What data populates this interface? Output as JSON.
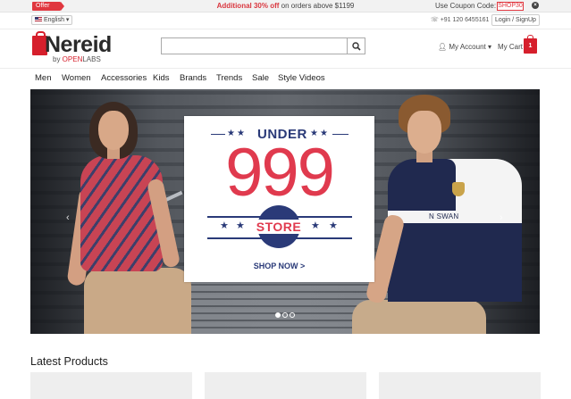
{
  "promo": {
    "offer_badge": "Offer",
    "highlight": "Additional 30% off",
    "text": " on orders above $1199",
    "coupon_label": "Use Coupon Code:",
    "coupon_code": "SHOP30",
    "close_glyph": "×"
  },
  "utility": {
    "language": "English",
    "phone": "+91 120 6455161",
    "login": "Login / SignUp"
  },
  "header": {
    "logo_main": "Nereid",
    "logo_by": "by ",
    "logo_open": "OPEN",
    "logo_labs": "LABS",
    "search_placeholder": "",
    "account": "My Account",
    "cart": "My Cart",
    "cart_count": "1"
  },
  "nav": [
    "Men",
    "Women",
    "Accessories",
    "Kids",
    "Brands",
    "Trends",
    "Sale",
    "Style Videos"
  ],
  "banner": {
    "under": "UNDER",
    "price": "999",
    "store": "STORE",
    "shop_now": "SHOP NOW >",
    "shirt_text": "N SWAN",
    "prev": "‹",
    "next": "›",
    "slide_count": 3,
    "active_slide": 1
  },
  "latest": {
    "title": "Latest Products"
  },
  "colors": {
    "brand_red": "#d61f2c",
    "sale_red": "#e03a4e",
    "navy": "#2a3a78"
  },
  "icons": [
    "search-icon",
    "user-icon",
    "cart-icon",
    "close-icon",
    "flag-icon"
  ]
}
